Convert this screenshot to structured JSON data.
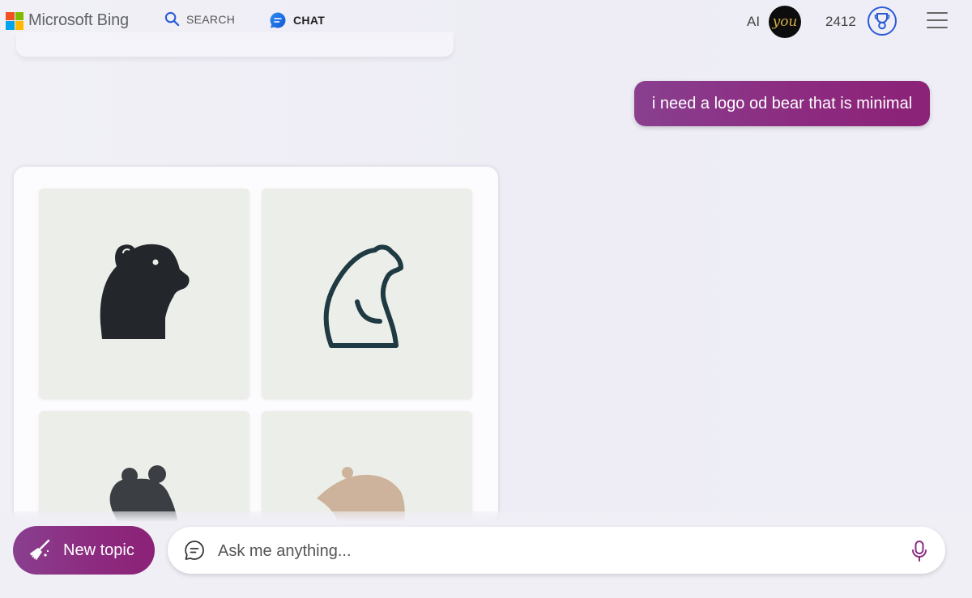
{
  "header": {
    "logo_text": "Microsoft Bing",
    "tabs": [
      {
        "label": "SEARCH",
        "icon": "search-icon",
        "active": false
      },
      {
        "label": "CHAT",
        "icon": "chat-icon",
        "active": true
      }
    ],
    "ai_label": "AI",
    "avatar_text": "you",
    "points": "2412",
    "accent_color": "#174ae4"
  },
  "conversation": {
    "user_message": "i need a logo od bear that is minimal",
    "images": [
      {
        "icon": "bear-logo-icon"
      },
      {
        "icon": "bear-logo-icon"
      },
      {
        "icon": "bear-logo-icon"
      },
      {
        "icon": "bear-logo-icon"
      }
    ]
  },
  "composer": {
    "new_topic_label": "New topic",
    "placeholder": "Ask me anything...",
    "brand_color": "#8b2d80"
  }
}
